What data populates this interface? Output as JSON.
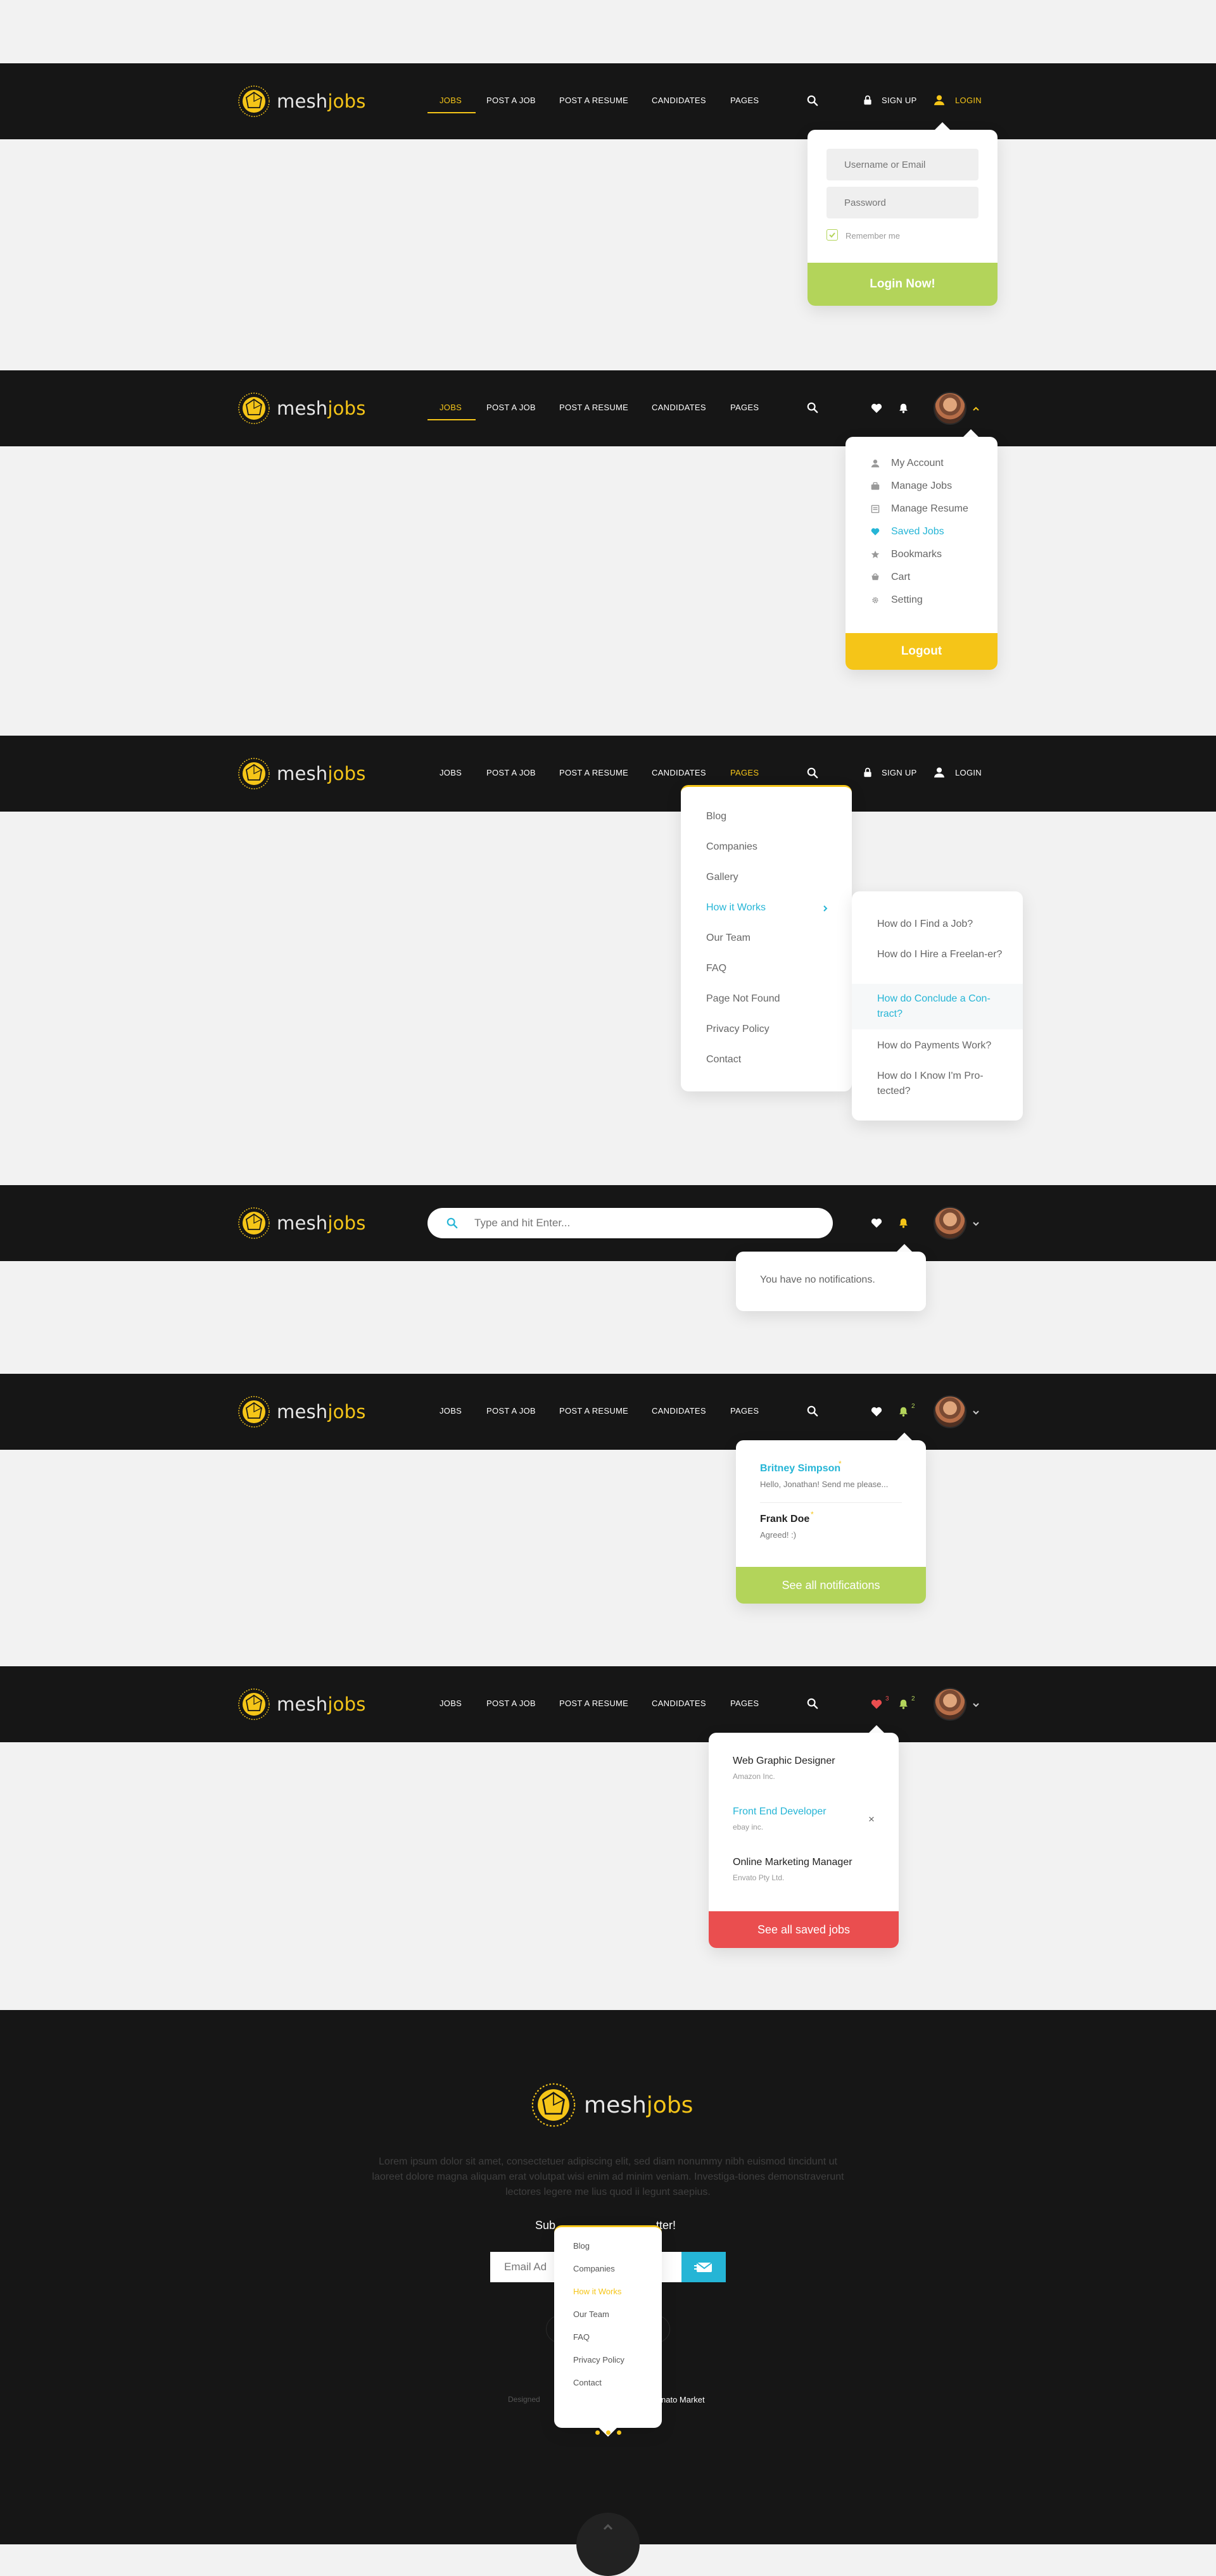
{
  "brand": {
    "part1": "mesh",
    "part2": "jobs"
  },
  "nav": {
    "jobs": "JOBS",
    "post_job": "POST A JOB",
    "post_resume": "POST A RESUME",
    "candidates": "CANDIDATES",
    "pages": "PAGES"
  },
  "auth": {
    "signup": "SIGN UP",
    "login": "LOGIN"
  },
  "login_form": {
    "username_placeholder": "Username or Email",
    "password_placeholder": "Password",
    "remember": "Remember me",
    "submit": "Login Now!"
  },
  "account_menu": {
    "items": [
      "My Account",
      "Manage Jobs",
      "Manage Resume",
      "Saved Jobs",
      "Bookmarks",
      "Cart",
      "Setting"
    ],
    "logout": "Logout"
  },
  "pages_menu": {
    "items": [
      "Blog",
      "Companies",
      "Gallery",
      "How it Works",
      "Our Team",
      "FAQ",
      "Page Not Found",
      "Privacy Policy",
      "Contact"
    ],
    "submenu": [
      "How do I Find a Job?",
      "How do I Hire a Freelan-er?",
      "How do Conclude a Con-tract?",
      "How do Payments Work?",
      "How do I Know I'm Pro-tected?"
    ]
  },
  "search": {
    "placeholder": "Type and hit Enter..."
  },
  "empty_notifications": {
    "text": "You have no notifications."
  },
  "notifications": {
    "count": "2",
    "items": [
      {
        "name": "Britney Simpson",
        "message": "Hello, Jonathan! Send me please..."
      },
      {
        "name": "Frank Doe",
        "message": "Agreed! :)"
      }
    ],
    "see_all": "See all notifications"
  },
  "saved_jobs": {
    "count": "3",
    "items": [
      {
        "title": "Web Graphic Designer",
        "company": "Amazon Inc."
      },
      {
        "title": "Front End Developer",
        "company": "ebay inc."
      },
      {
        "title": "Online Marketing Manager",
        "company": "Envato Pty Ltd."
      }
    ],
    "remove": "×",
    "see_all": "See all saved jobs"
  },
  "footer": {
    "about": "Lorem ipsum dolor sit amet, consectetuer adipiscing elit, sed diam nonummy nibh euismod tincidunt ut laoreet dolore magna aliquam erat volutpat wisi enim ad minim veniam. Investiga-tiones demonstraverunt lectores legere me lius quod ii legunt saepius.",
    "subscribe_left": "Sub",
    "subscribe_right": "tter!",
    "email_placeholder": "Email Ad",
    "designed_by": "Designed",
    "market": "nato Market",
    "menu": [
      "Blog",
      "Companies",
      "How it Works",
      "Our Team",
      "FAQ",
      "Privacy Policy",
      "Contact"
    ]
  },
  "colors": {
    "yellow": "#f5c518",
    "green": "#b3d45a",
    "teal": "#25b5d6",
    "red": "#ea4e4f",
    "dark": "#161616"
  }
}
